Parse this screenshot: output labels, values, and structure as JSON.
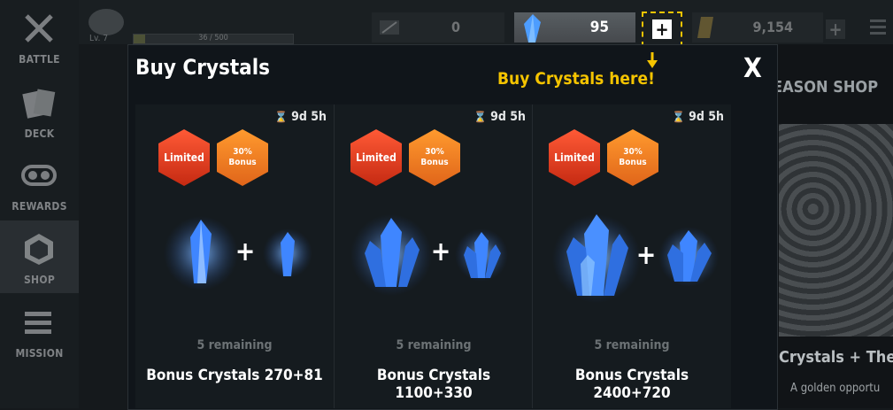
{
  "nav": {
    "items": [
      {
        "label": "BATTLE",
        "icon": "crossed-swords-icon"
      },
      {
        "label": "DECK",
        "icon": "cards-icon"
      },
      {
        "label": "REWARDS",
        "icon": "reel-icon"
      },
      {
        "label": "SHOP",
        "icon": "shop-crate-icon"
      },
      {
        "label": "MISSION",
        "icon": "mission-list-icon"
      }
    ],
    "active": "SHOP"
  },
  "player": {
    "level": "Lv. 7",
    "xp": "36 / 500",
    "xp_fraction": 0.072
  },
  "currencies": {
    "first_value": "0",
    "crystals": "95",
    "gold": "9,154"
  },
  "modal": {
    "title": "Buy Crystals",
    "close": "X",
    "callout": "Buy Crystals here!"
  },
  "shop_bg": {
    "title": "EASON SHOP",
    "caption": "Crystals + The I",
    "sub": "A golden opportu"
  },
  "offers": [
    {
      "timer": "9d 5h",
      "badge_limited": "Limited",
      "badge_bonus": "30%\nBonus",
      "remaining": "5 remaining",
      "name": "Bonus Crystals 270+81"
    },
    {
      "timer": "9d 5h",
      "badge_limited": "Limited",
      "badge_bonus": "30%\nBonus",
      "remaining": "5 remaining",
      "name": "Bonus Crystals\n1100+330"
    },
    {
      "timer": "9d 5h",
      "badge_limited": "Limited",
      "badge_bonus": "30%\nBonus",
      "remaining": "5 remaining",
      "name": "Bonus Crystals\n2400+720"
    }
  ],
  "colors": {
    "accent": "#f5c400",
    "limited": "#e8431f",
    "bonus": "#f07b1e",
    "crystal": "#3f8cff"
  }
}
